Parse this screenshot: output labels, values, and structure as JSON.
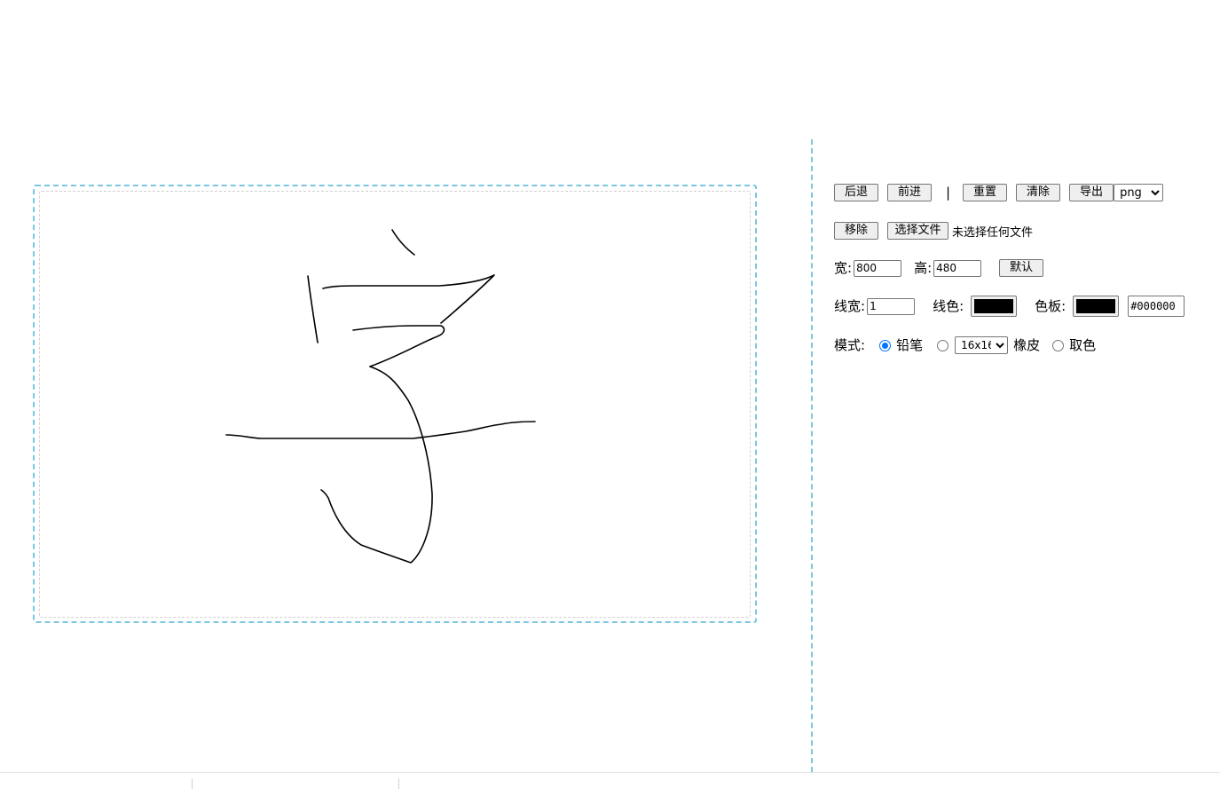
{
  "toolbar": {
    "undo_label": "后退",
    "redo_label": "前进",
    "separator": "|",
    "reset_label": "重置",
    "clear_label": "清除",
    "export_label": "导出",
    "export_format": "png"
  },
  "file": {
    "remove_label": "移除",
    "choose_label": "选择文件",
    "status_text": "未选择任何文件"
  },
  "size": {
    "width_label": "宽:",
    "width_value": "800",
    "height_label": "高:",
    "height_value": "480",
    "default_label": "默认"
  },
  "stroke": {
    "line_width_label": "线宽:",
    "line_width_value": "1",
    "line_color_label": "线色:",
    "line_color": "#000000",
    "palette_label": "色板:",
    "palette_color": "#000000",
    "hex_value": "#000000"
  },
  "mode": {
    "label": "模式:",
    "pencil_label": "铅笔",
    "eraser_size": "16x16",
    "eraser_label": "橡皮",
    "picker_label": "取色",
    "selected": "pencil"
  },
  "canvas": {
    "accent_border": "#7cc7e0",
    "ink_color": "#000000"
  }
}
